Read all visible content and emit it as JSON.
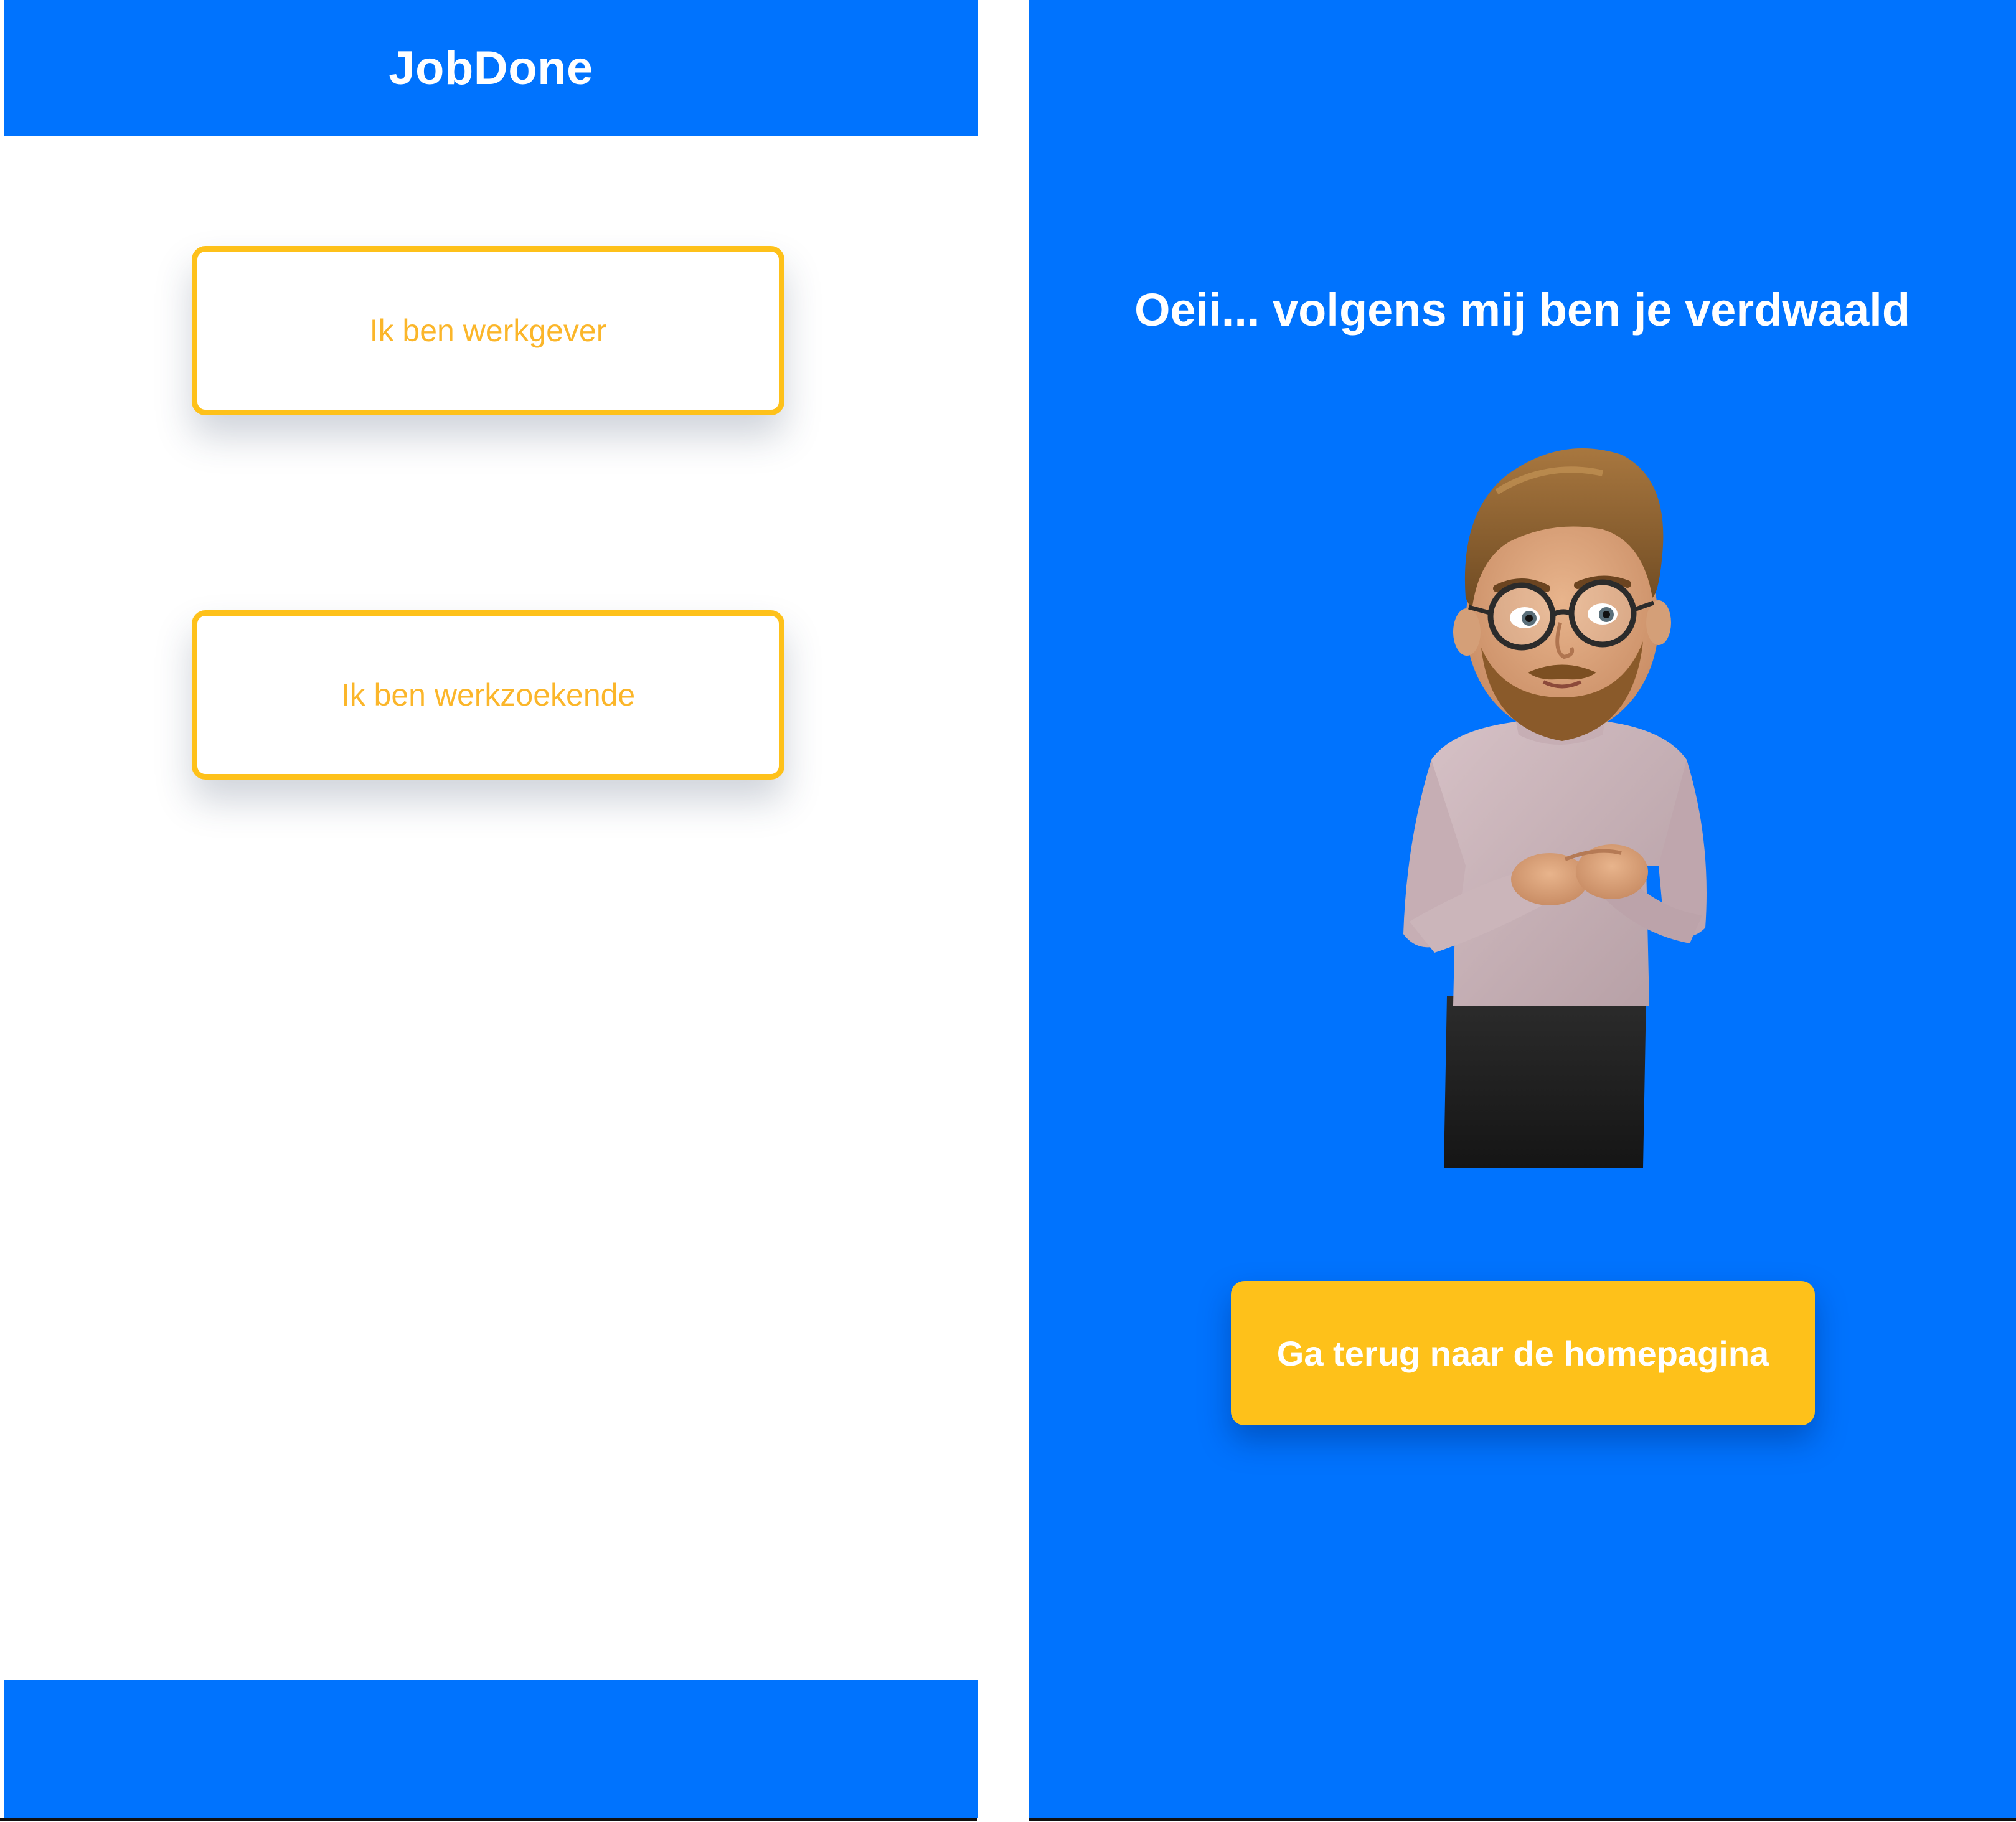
{
  "left_screen": {
    "header": {
      "title": "JobDone"
    },
    "choices": [
      {
        "label": "Ik ben werkgever"
      },
      {
        "label": "Ik ben werkzoekende"
      }
    ]
  },
  "right_screen": {
    "heading": "Oeii... volgens mij ben je verdwaald",
    "home_button": {
      "label": "Ga terug naar de homepagina"
    }
  },
  "colors": {
    "primary_blue": "#0073fe",
    "accent_yellow": "#fec11a",
    "choice_text": "#fbb62a",
    "white": "#ffffff"
  },
  "icons": {
    "avatar": "memoji-man-with-glasses-avatar"
  }
}
